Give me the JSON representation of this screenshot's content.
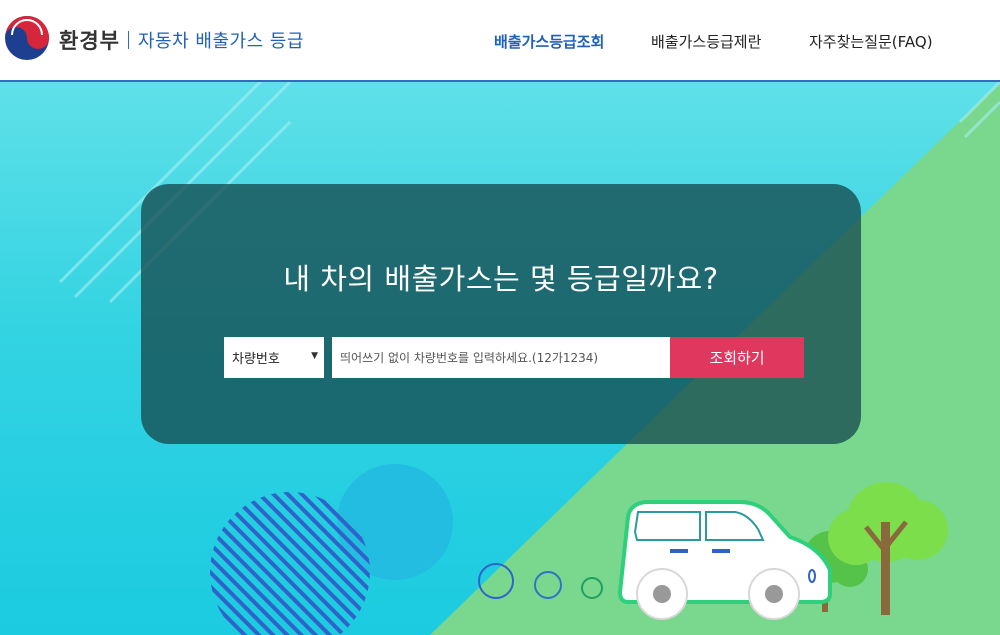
{
  "header": {
    "ministry": "환경부",
    "service": "자동차 배출가스 등급",
    "nav": [
      {
        "label": "배출가스등급조회",
        "active": true
      },
      {
        "label": "배출가스등급제란",
        "active": false
      },
      {
        "label": "자주찾는질문(FAQ)",
        "active": false
      }
    ]
  },
  "hero": {
    "headline": "내 차의 배출가스는 몇 등급일까요?",
    "search": {
      "select_value": "차량번호",
      "placeholder": "띄어쓰기 없이 차량번호를 입력하세요.(12가1234)",
      "button_label": "조회하기"
    }
  },
  "colors": {
    "brand_blue": "#1f60b8",
    "button": "#e0375e",
    "panel": "#164b50",
    "sky": "#33d3e2",
    "grass": "#79d98e"
  },
  "icons": [
    "government-emblem-icon",
    "dropdown-arrow-icon",
    "car-illustration",
    "tree-illustration"
  ]
}
